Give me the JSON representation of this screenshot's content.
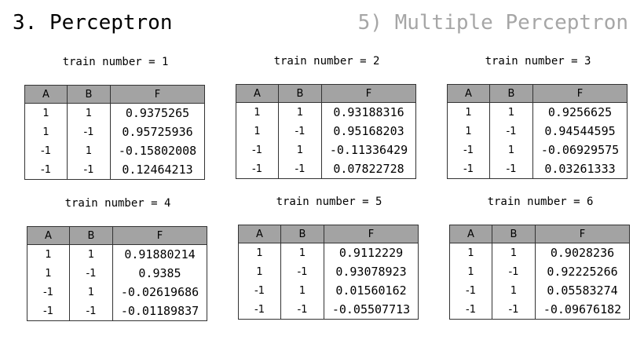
{
  "header": {
    "title": "3. Perceptron",
    "subtitle": "5) Multiple Perceptron"
  },
  "columns": [
    "A",
    "B",
    "F"
  ],
  "trains": [
    {
      "caption": "train number = 1",
      "rows": [
        [
          "1",
          "1",
          "0.9375265"
        ],
        [
          "1",
          "-1",
          "0.95725936"
        ],
        [
          "-1",
          "1",
          "-0.15802008"
        ],
        [
          "-1",
          "-1",
          "0.12464213"
        ]
      ]
    },
    {
      "caption": "train number = 2",
      "rows": [
        [
          "1",
          "1",
          "0.93188316"
        ],
        [
          "1",
          "-1",
          "0.95168203"
        ],
        [
          "-1",
          "1",
          "-0.11336429"
        ],
        [
          "-1",
          "-1",
          "0.07822728"
        ]
      ]
    },
    {
      "caption": "train number = 3",
      "rows": [
        [
          "1",
          "1",
          "0.9256625"
        ],
        [
          "1",
          "-1",
          "0.94544595"
        ],
        [
          "-1",
          "1",
          "-0.06929575"
        ],
        [
          "-1",
          "-1",
          "0.03261333"
        ]
      ]
    },
    {
      "caption": "train number = 4",
      "rows": [
        [
          "1",
          "1",
          "0.91880214"
        ],
        [
          "1",
          "-1",
          "0.9385"
        ],
        [
          "-1",
          "1",
          "-0.02619686"
        ],
        [
          "-1",
          "-1",
          "-0.01189837"
        ]
      ]
    },
    {
      "caption": "train number = 5",
      "rows": [
        [
          "1",
          "1",
          "0.9112229"
        ],
        [
          "1",
          "-1",
          "0.93078923"
        ],
        [
          "-1",
          "1",
          "0.01560162"
        ],
        [
          "-1",
          "-1",
          "-0.05507713"
        ]
      ]
    },
    {
      "caption": "train number = 6",
      "rows": [
        [
          "1",
          "1",
          "0.9028236"
        ],
        [
          "1",
          "-1",
          "0.92225266"
        ],
        [
          "-1",
          "1",
          "0.05583274"
        ],
        [
          "-1",
          "-1",
          "-0.09676182"
        ]
      ]
    }
  ]
}
